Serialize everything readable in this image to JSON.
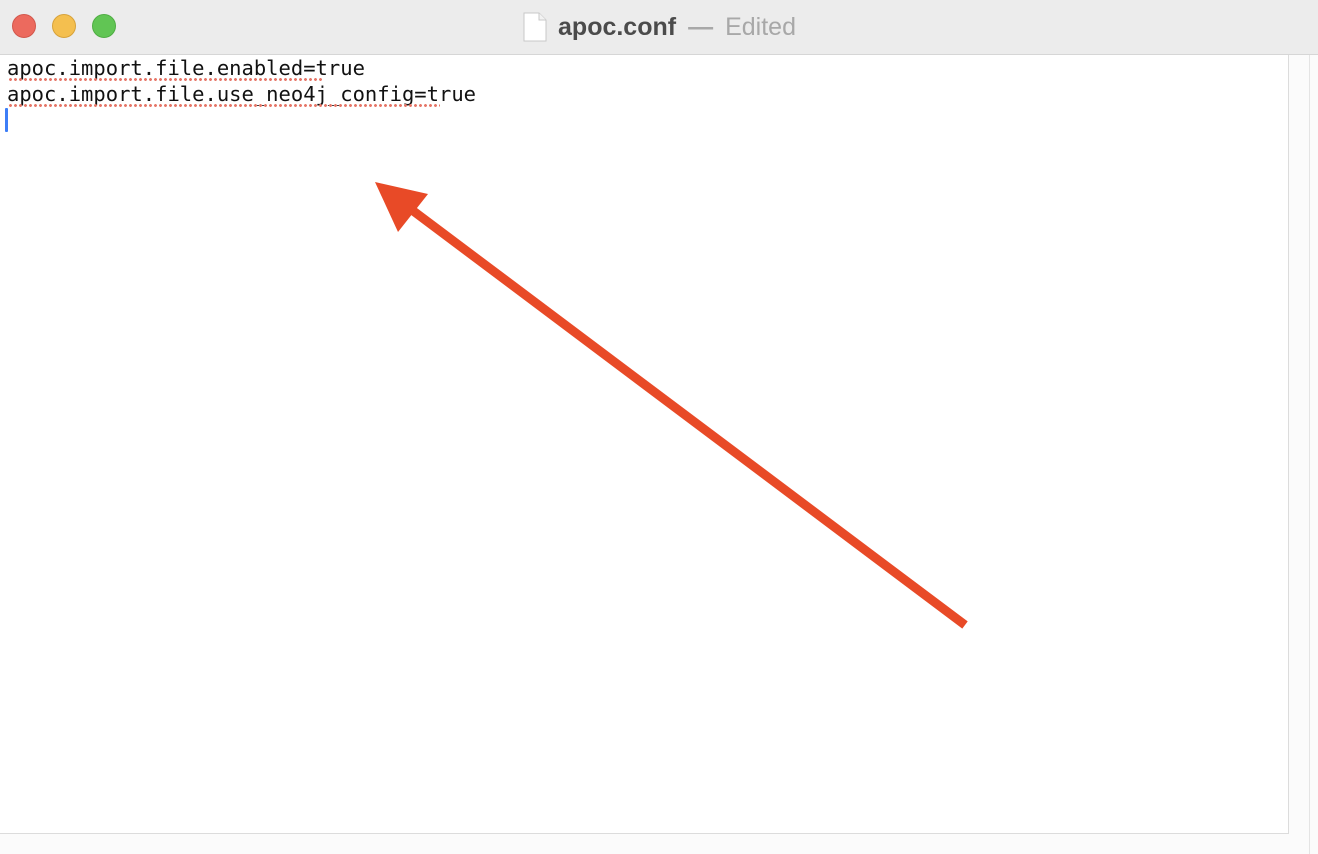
{
  "window": {
    "title": "apoc.conf",
    "separator": "—",
    "status": "Edited"
  },
  "editor": {
    "lines": [
      "apoc.import.file.enabled=true",
      "apoc.import.file.use_neo4j_config=true"
    ]
  },
  "annotation": {
    "type": "arrow",
    "color": "#e84a27"
  },
  "colors": {
    "close": "#ec6a5e",
    "minimize": "#f4bf4f",
    "zoom": "#61c554",
    "caret": "#3d7ef7",
    "spellcheck": "#e6786a"
  },
  "icons": {
    "document": "document-icon"
  }
}
